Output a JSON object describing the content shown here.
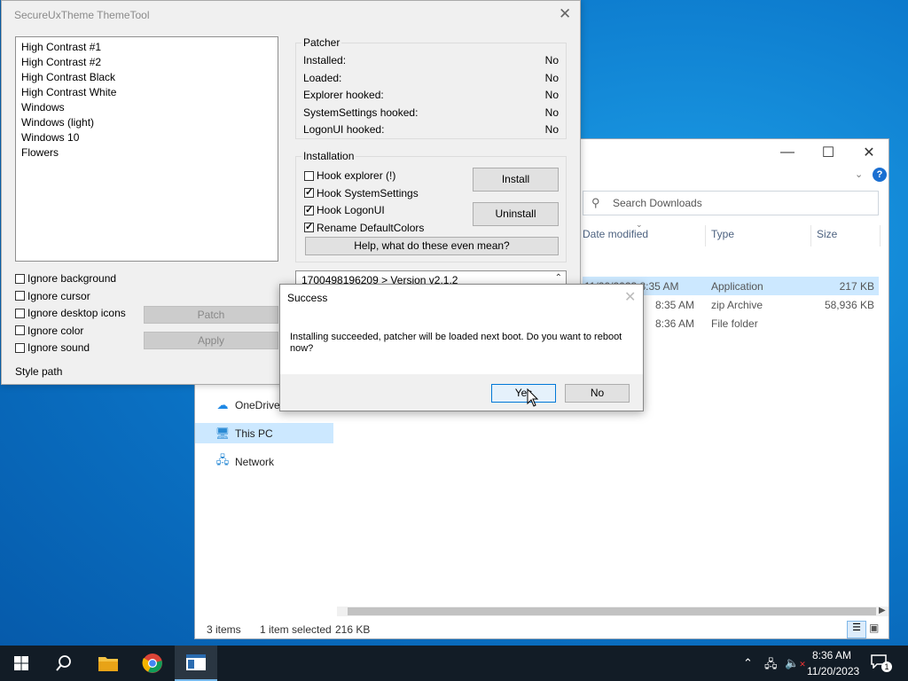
{
  "explorer": {
    "search_placeholder": "Search Downloads",
    "columns": [
      "Date modified",
      "Type",
      "Size"
    ],
    "rows": [
      {
        "date": "11/20/2023 8:35 AM",
        "type": "Application",
        "size": "217 KB"
      },
      {
        "date": "8:35 AM",
        "type": "zip Archive",
        "size": "58,936 KB"
      },
      {
        "date": "8:36 AM",
        "type": "File folder",
        "size": ""
      }
    ],
    "nav": [
      "OneDrive",
      "This PC",
      "Network"
    ],
    "status": {
      "items": "3 items",
      "selected": "1 item selected",
      "size": "216 KB"
    }
  },
  "themetool": {
    "title": "SecureUxTheme ThemeTool",
    "themes": [
      "High Contrast #1",
      "High Contrast #2",
      "High Contrast Black",
      "High Contrast White",
      "Windows",
      "Windows (light)",
      "Windows 10",
      "Flowers"
    ],
    "ignore_options": [
      {
        "label": "Ignore background",
        "checked": false
      },
      {
        "label": "Ignore cursor",
        "checked": false
      },
      {
        "label": "Ignore desktop icons",
        "checked": false
      },
      {
        "label": "Ignore color",
        "checked": false
      },
      {
        "label": "Ignore sound",
        "checked": false
      }
    ],
    "patch_label": "Patch",
    "apply_label": "Apply",
    "style_path_label": "Style path",
    "patcher": {
      "title": "Patcher",
      "rows": [
        {
          "label": "Installed:",
          "value": "No"
        },
        {
          "label": "Loaded:",
          "value": "No"
        },
        {
          "label": "Explorer hooked:",
          "value": "No"
        },
        {
          "label": "SystemSettings hooked:",
          "value": "No"
        },
        {
          "label": "LogonUI hooked:",
          "value": "No"
        }
      ]
    },
    "installation": {
      "title": "Installation",
      "options": [
        {
          "label": "Hook explorer (!)",
          "checked": false
        },
        {
          "label": "Hook SystemSettings",
          "checked": true
        },
        {
          "label": "Hook LogonUI",
          "checked": true
        },
        {
          "label": "Rename DefaultColors",
          "checked": true
        }
      ],
      "install_label": "Install",
      "uninstall_label": "Uninstall",
      "help_label": "Help, what do these even mean?"
    },
    "version": "1700498196209 > Version v2.1.2"
  },
  "dialog": {
    "title": "Success",
    "message": "Installing succeeded, patcher will be loaded next boot. Do you want to reboot now?",
    "yes_label": "Yes",
    "no_label": "No"
  },
  "taskbar": {
    "time": "8:36 AM",
    "date": "11/20/2023",
    "notification_count": "1"
  }
}
